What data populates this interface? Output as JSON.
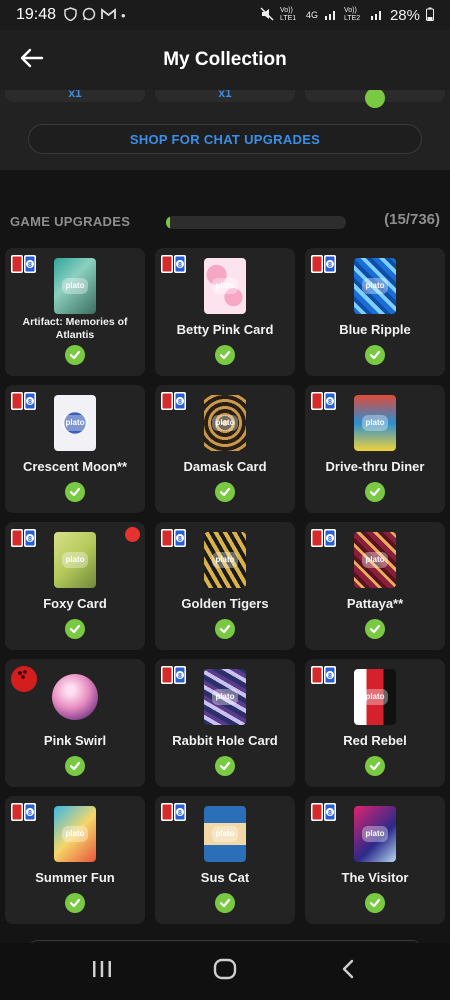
{
  "status_bar": {
    "time": "19:48",
    "battery": "28%",
    "net1": "Vo)) LTE1",
    "net2": "4G",
    "net3": "Vo)) LTE2"
  },
  "header": {
    "title": "My Collection"
  },
  "chat_upgrades": {
    "partial_labels": [
      "x1",
      "x1"
    ],
    "shop_label": "SHOP FOR CHAT UPGRADES"
  },
  "game_upgrades": {
    "title": "GAME UPGRADES",
    "progress_text": "(15/736)",
    "progress_fraction": 0.02,
    "items": [
      {
        "label": "Artifact: Memories of Atlantis",
        "art": "artifact"
      },
      {
        "label": "Betty Pink Card",
        "art": "betty"
      },
      {
        "label": "Blue Ripple",
        "art": "blue"
      },
      {
        "label": "Crescent Moon**",
        "art": "crescent"
      },
      {
        "label": "Damask Card",
        "art": "damask"
      },
      {
        "label": "Drive-thru Diner",
        "art": "diner"
      },
      {
        "label": "Foxy Card",
        "art": "foxy"
      },
      {
        "label": "Golden Tigers",
        "art": "tigers"
      },
      {
        "label": "Pattaya**",
        "art": "pattaya"
      },
      {
        "label": "Pink Swirl",
        "art": "swirl"
      },
      {
        "label": "Rabbit Hole Card",
        "art": "rabbit"
      },
      {
        "label": "Red Rebel",
        "art": "rebel"
      },
      {
        "label": "Summer Fun",
        "art": "summer"
      },
      {
        "label": "Sus Cat",
        "art": "suscat"
      },
      {
        "label": "The Visitor",
        "art": "visitor"
      }
    ],
    "card_logo": "plato"
  },
  "colors": {
    "accent_green": "#7ac943",
    "link_blue": "#3b8ee8",
    "badge_red": "#e8322f"
  }
}
